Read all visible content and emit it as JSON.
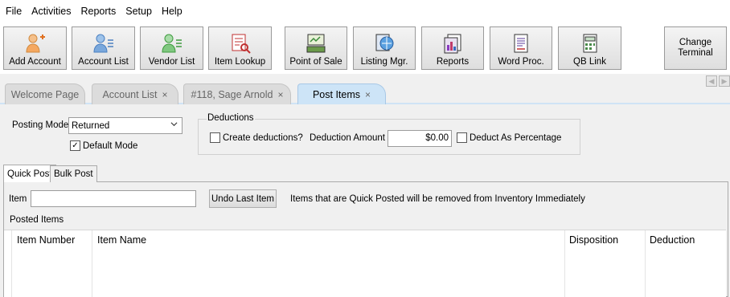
{
  "menu": [
    "File",
    "Activities",
    "Reports",
    "Setup",
    "Help"
  ],
  "toolbar": {
    "buttons": [
      {
        "label": "Add Account",
        "icon": "add-account-icon"
      },
      {
        "label": "Account List",
        "icon": "account-list-icon"
      },
      {
        "label": "Vendor List",
        "icon": "vendor-list-icon"
      },
      {
        "label": "Item Lookup",
        "icon": "item-lookup-icon"
      },
      {
        "label": "Point of Sale",
        "icon": "point-of-sale-icon"
      },
      {
        "label": "Listing Mgr.",
        "icon": "listing-manager-icon"
      },
      {
        "label": "Reports",
        "icon": "reports-icon"
      },
      {
        "label": "Word Proc.",
        "icon": "word-processor-icon"
      },
      {
        "label": "QB Link",
        "icon": "qb-link-icon"
      }
    ],
    "change_terminal_line1": "Change",
    "change_terminal_line2": "Terminal"
  },
  "doc_tabs": [
    {
      "label": "Welcome Page",
      "closable": false
    },
    {
      "label": "Account List",
      "closable": true
    },
    {
      "label": "#118, Sage Arnold",
      "closable": true
    },
    {
      "label": "Post Items",
      "closable": true,
      "active": true
    }
  ],
  "close_glyph": "×",
  "posting": {
    "label": "Posting Mode",
    "value": "Returned",
    "default_mode_label": "Default Mode",
    "default_mode_checked": true
  },
  "deductions": {
    "title": "Deductions",
    "create_label": "Create deductions?",
    "amount_label": "Deduction Amount",
    "amount_value": "$0.00",
    "percentage_label": "Deduct As Percentage"
  },
  "sub_tabs": [
    {
      "label": "Quick Post",
      "active": true
    },
    {
      "label": "Bulk Post",
      "active": false
    }
  ],
  "quick_post": {
    "item_label": "Item",
    "item_value": "",
    "undo_label": "Undo Last Item",
    "note": "Items that are Quick Posted will be removed from Inventory Immediately",
    "posted_label": "Posted Items"
  },
  "grid": {
    "columns": [
      "Item Number",
      "Item Name",
      "Disposition",
      "Deduction"
    ]
  },
  "colors": {
    "active_tab": "#cde4f7",
    "toolbar_bg": "#ffffff",
    "window_bg": "#f0f0f0"
  }
}
